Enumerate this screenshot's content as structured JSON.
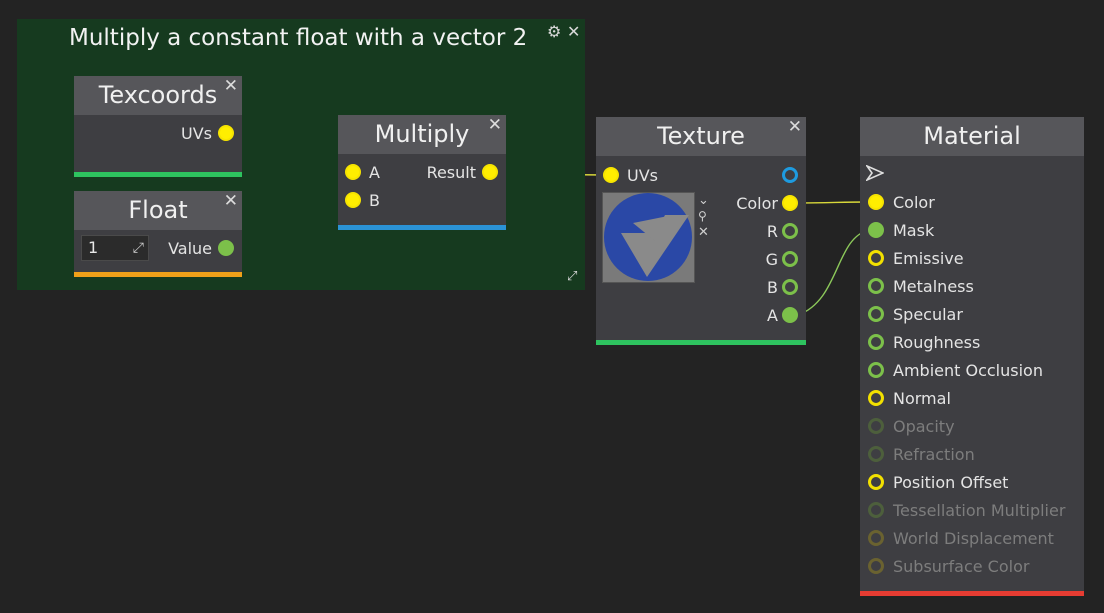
{
  "comment": {
    "title": "Multiply a constant float with a vector 2",
    "gear_icon": "⚙",
    "close_icon": "✕",
    "resize_icon": "⤢"
  },
  "nodes": {
    "texcoords": {
      "title": "Texcoords",
      "outputs": [
        "UVs"
      ]
    },
    "float": {
      "title": "Float",
      "value": "1",
      "outputs": [
        "Value"
      ]
    },
    "multiply": {
      "title": "Multiply",
      "inputs": [
        "A",
        "B"
      ],
      "outputs": [
        "Result"
      ]
    },
    "texture": {
      "title": "Texture",
      "inputs": [
        "UVs"
      ],
      "outputs": [
        "Color",
        "R",
        "G",
        "B",
        "A"
      ],
      "preview_icons": [
        "chevron-down-icon",
        "search-icon",
        "close-icon"
      ]
    },
    "material": {
      "title": "Material",
      "inputs": [
        {
          "label": "Color",
          "enabled": true
        },
        {
          "label": "Mask",
          "enabled": true
        },
        {
          "label": "Emissive",
          "enabled": true
        },
        {
          "label": "Metalness",
          "enabled": true
        },
        {
          "label": "Specular",
          "enabled": true
        },
        {
          "label": "Roughness",
          "enabled": true
        },
        {
          "label": "Ambient Occlusion",
          "enabled": true
        },
        {
          "label": "Normal",
          "enabled": true
        },
        {
          "label": "Opacity",
          "enabled": false
        },
        {
          "label": "Refraction",
          "enabled": false
        },
        {
          "label": "Position Offset",
          "enabled": true
        },
        {
          "label": "Tessellation Multiplier",
          "enabled": false
        },
        {
          "label": "World Displacement",
          "enabled": false
        },
        {
          "label": "Subsurface Color",
          "enabled": false
        }
      ]
    }
  },
  "colors": {
    "background": "#232323",
    "comment_bg": "#163a1f",
    "float_yellow": "#ffee00",
    "vector_green": "#7cc04a",
    "texcoords_bar": "#2ec35f",
    "float_bar": "#f0a019",
    "multiply_bar": "#2b93d6",
    "texture_bar": "#2ec35f",
    "material_bar": "#e63c32"
  }
}
